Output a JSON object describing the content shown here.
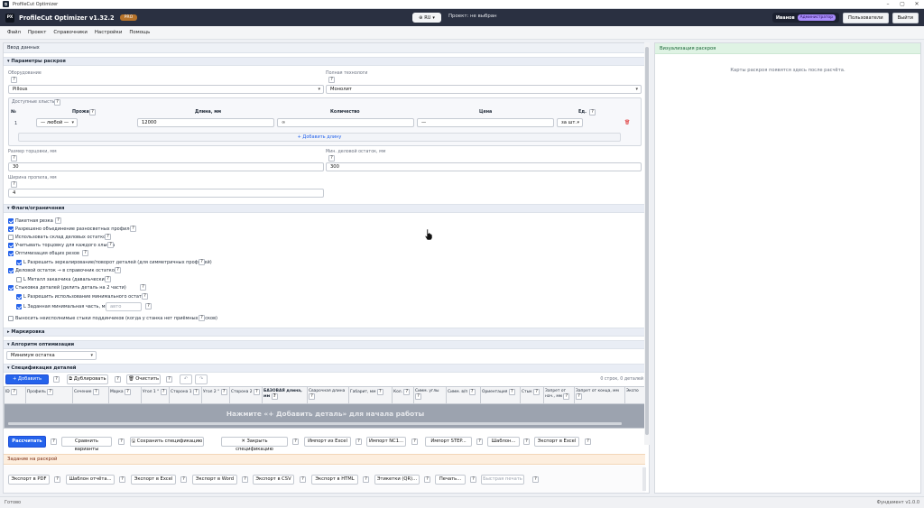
{
  "window": {
    "title": "ProfileCut Optimizer"
  },
  "header": {
    "logo_text": "PX",
    "app_name": "ProfileCut Optimizer v1.32.2",
    "badge": "PRO",
    "language": "RU",
    "project": "Проект: не выбран",
    "user_name": "Иванов",
    "role": "Администратор",
    "users_button": "Пользователи",
    "logout_button": "Выйти"
  },
  "menu": [
    "Файл",
    "Проект",
    "Справочники",
    "Настройки",
    "Помощь"
  ],
  "input_panel": {
    "title": "Ввод данных",
    "cut_params": {
      "title": "▾ Параметры раскроя",
      "equipment_label": "Оборудование",
      "equipment_value": "Pillous",
      "technology_label": "Полная технологи",
      "technology_value": "Монолит",
      "whips_label": "Доступные хлысты",
      "whips_columns": [
        "№",
        "Прожат",
        "Длина, мм",
        "Количество",
        "Цена",
        "Ед."
      ],
      "whip_row": {
        "n": "1",
        "profile": "— любой —",
        "length": "12000",
        "qty": "∞",
        "price": "—",
        "unit": "за шт."
      },
      "add_length": "+ Добавить длину",
      "trim_label": "Размер торцовки, мм",
      "trim_value": "30",
      "min_rest_label": "Мин. деловой остаток, мм",
      "min_rest_value": "300",
      "kerf_label": "Ширина пропила, мм",
      "kerf_value": "4"
    },
    "flags": {
      "title": "▾ Флаги/ограничения",
      "items": [
        {
          "label": "Пакетная резка",
          "checked": true
        },
        {
          "label": "Разрешено объединение разносветных профилей",
          "checked": true
        },
        {
          "label": "Использовать склад деловых остатков",
          "checked": false
        },
        {
          "label": "Учитывать торцовку для каждого хлыста",
          "checked": true
        },
        {
          "label": "Оптимизация общих резов",
          "checked": true
        },
        {
          "label": "L Разрешить зеркалирование/поворот деталей (для симметричных профилей)",
          "checked": true
        },
        {
          "label": "Деловой остаток → в справочник остатков",
          "checked": true
        },
        {
          "label": "L Металл заказчика (давальческий)",
          "checked": false
        },
        {
          "label": "Стыковка деталей (делить деталь на 2 части)",
          "checked": true
        },
        {
          "label": "L Разрешить использование минимального остатка",
          "checked": true
        },
        {
          "label": "L Заданная минимальная часть, мм:",
          "checked": true
        },
        {
          "label": "Выносить неисполнимые стыки поддинчиков (когда у станка нет приёмных тисков)",
          "checked": false
        }
      ],
      "min_part_placeholder": "авто"
    },
    "marking": {
      "title": "▸ Маркировка"
    },
    "algorithm": {
      "title": "▾ Алгоритм оптимизации",
      "value": "Минимум остатка"
    },
    "spec": {
      "title": "▾ Спецификация деталей",
      "add_button": "+ Добавить деталь",
      "duplicate_button": "⧉ Дублировать",
      "clear_button": "🗑 Очистить",
      "undo": "↶",
      "redo": "↷",
      "count": "0 строк, 0 деталей",
      "columns": [
        "ID",
        "Профиль",
        "Сечение",
        "Марка",
        "Угол 1 °",
        "Сторона 1",
        "Угол 2 °",
        "Сторона 2",
        "БАЗОВАЯ длина, мм",
        "Сварочная длина",
        "Габарит, мм",
        "Кол.",
        "Симм. углы",
        "Симм. в/п",
        "Ориентация",
        "Стык",
        "Запрет от нач., мм",
        "Запрет от конца, мм",
        "Экспо"
      ],
      "empty_hint": "Нажмите «+ Добавить деталь» для начала работы"
    },
    "actions": [
      "Рассчитать",
      "Сравнить варианты",
      "Сохранить спецификацию",
      "Закрыть спецификацию",
      "Импорт из Excel",
      "Импорт NC1...",
      "Импорт STEP...",
      "Шаблон...",
      "Экспорт в Excel"
    ],
    "task": {
      "title": "Задание на раскрой",
      "buttons": [
        "Экспорт в PDF",
        "Шаблон отчёта...",
        "Экспорт в Excel",
        "Экспорт в Word",
        "Экспорт в CSV",
        "Экспорт в HTML",
        "Этикетки (QR)...",
        "Печать...",
        "Быстрая печать"
      ]
    }
  },
  "visual_panel": {
    "title": "Визуализация раскроя",
    "message": "Карты раскроя появятся здесь после расчёта."
  },
  "status": {
    "left": "Готово",
    "right": "Фундамент v1.0.0"
  },
  "colors": {
    "header": "#2a3041",
    "primary": "#2563eb",
    "pro_badge": "#b6732b",
    "role_badge": "#a78bfa",
    "viz_header": "#dff3e4",
    "task_header": "#fdeede",
    "grid_empty": "#9ca3af"
  }
}
